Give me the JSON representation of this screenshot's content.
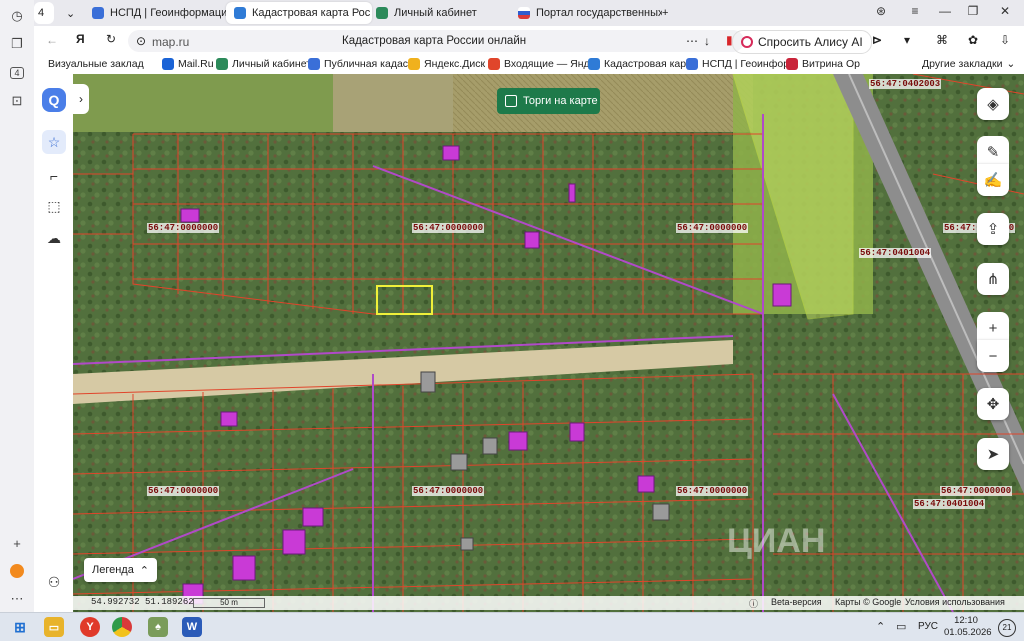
{
  "browser": {
    "tab_count": "4",
    "tabs": [
      {
        "label": "НСПД | Геоинформацион",
        "icon": "nspd-icon",
        "color": "#3a6fd8"
      },
      {
        "label": "Кадастровая карта Рос",
        "icon": "cadastral-map-icon",
        "color": "#2f7bd6",
        "active": true
      },
      {
        "label": "Личный кабинет",
        "icon": "tax-icon",
        "color": "#2c8a5a"
      },
      {
        "label": "Портал государственных",
        "icon": "gosuslugi-icon",
        "color": "#d93a3a"
      }
    ],
    "url": "map.ru",
    "page_title": "Кадастровая карта России онлайн",
    "alice_label": "Спросить Алису AI",
    "bookmarks": [
      "Визуальные заклад",
      "Mail.Ru",
      "Личный кабинет",
      "Публичная кадас",
      "Яндекс.Диск",
      "Входящие — Янде",
      "Кадастровая карт",
      "НСПД | Геоинфор",
      "Витрина Ор"
    ],
    "other_bookmarks": "Другие закладки"
  },
  "map": {
    "torgi_label": "Торги на карте",
    "legend_label": "Легенда",
    "plot_labels": [
      "56:47:0402003",
      "56:47:0000000",
      "56:47:0000000",
      "56:47:0000000",
      "56:47:0401004",
      "56:47:0000000",
      "56:47:0000000",
      "56:47:0000000",
      "56:47:0000000",
      "56:47:0000000",
      "56:47:0401004"
    ],
    "coordinates": "54.992732   51.189262",
    "scale": "50 m",
    "beta": "Beta-версия",
    "attribution": "Карты © Google",
    "terms": "Условия использования",
    "watermark": "ЦИАН"
  },
  "taskbar": {
    "lang": "РУС",
    "time": "12:10",
    "date": "01.05.2026",
    "notifications": "21"
  },
  "colors": {
    "parcel_border": "#e0452b",
    "selected_parcel": "#f0f03a",
    "district_border": "#b04ac8",
    "building": "#c93ad6"
  }
}
